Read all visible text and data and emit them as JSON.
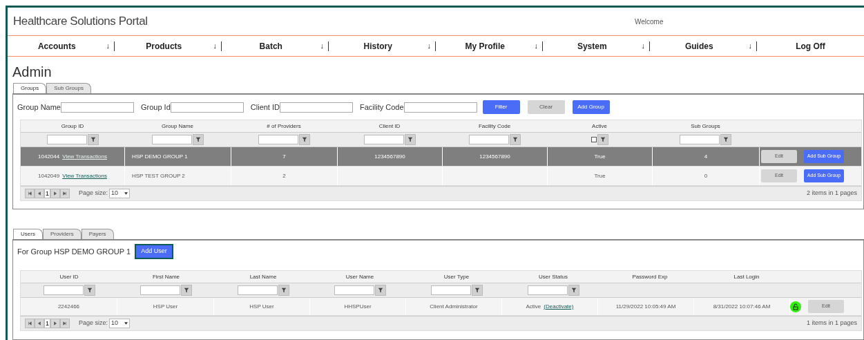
{
  "header": {
    "title": "Healthcare Solutions Portal",
    "welcome": "Welcome"
  },
  "nav": [
    {
      "label": "Accounts",
      "arrow": "↓"
    },
    {
      "label": "Products",
      "arrow": "↓"
    },
    {
      "label": "Batch",
      "arrow": "↓"
    },
    {
      "label": "History",
      "arrow": "↓"
    },
    {
      "label": "My Profile",
      "arrow": "↓"
    },
    {
      "label": "System",
      "arrow": "↓"
    },
    {
      "label": "Guides",
      "arrow": "↓"
    },
    {
      "label": "Log Off"
    }
  ],
  "page_title": "Admin",
  "group_tabs": [
    {
      "label": "Groups",
      "selected": true
    },
    {
      "label": "Sub Groups",
      "selected": false
    }
  ],
  "filter_form": {
    "fields": [
      {
        "label": "Group Name"
      },
      {
        "label": "Group Id"
      },
      {
        "label": "Client ID"
      },
      {
        "label": "Facility Code"
      }
    ],
    "buttons": [
      {
        "label": "Filter",
        "kind": "primary"
      },
      {
        "label": "Clear",
        "kind": "secondary"
      },
      {
        "label": "Add Group",
        "kind": "primary"
      }
    ]
  },
  "groups_grid": {
    "columns": [
      {
        "label": "Group ID",
        "kind": "field"
      },
      {
        "label": "Group Name",
        "kind": "field"
      },
      {
        "label": "# of Providers",
        "kind": "field"
      },
      {
        "label": "Client ID",
        "kind": "field"
      },
      {
        "label": "Facility Code",
        "kind": "field"
      },
      {
        "label": "Active",
        "kind": "checkbox",
        "checked": false
      },
      {
        "label": "Sub Groups",
        "kind": "field"
      },
      {
        "kind": "plain"
      }
    ],
    "rows": [
      {
        "selected": true,
        "cells": [
          {
            "text": "1042044",
            "link": "View Transactions"
          },
          {
            "text": "HSP DEMO GROUP 1"
          },
          {
            "text": "7"
          },
          {
            "text": "1234567890"
          },
          {
            "text": "1234567890"
          },
          {
            "text": "True"
          },
          {
            "text": "4"
          }
        ],
        "actions": [
          {
            "label": "Edit",
            "kind": "secondary"
          },
          {
            "label": "Add Sub Group",
            "kind": "primary"
          }
        ]
      },
      {
        "selected": false,
        "cells": [
          {
            "text": "1042049",
            "link": "View Transactions"
          },
          {
            "text": "HSP TEST GROUP 2"
          },
          {
            "text": "2"
          },
          {},
          {},
          {
            "text": "True"
          },
          {
            "text": "0"
          }
        ],
        "actions": [
          {
            "label": "Edit",
            "kind": "secondary"
          },
          {
            "label": "Add Sub Group",
            "kind": "primary"
          }
        ]
      }
    ],
    "pager": {
      "page": "1",
      "page_size_label": "Page size:",
      "page_size": "10",
      "summary": "2 items in 1 pages"
    }
  },
  "user_tabs": [
    {
      "label": "Users",
      "selected": true
    },
    {
      "label": "Providers",
      "selected": false
    },
    {
      "label": "Payers",
      "selected": false
    }
  ],
  "group_caption": "For Group HSP DEMO GROUP 1",
  "add_user_button": {
    "label": "Add User",
    "focused": true
  },
  "users_grid": {
    "columns": [
      {
        "label": "User ID",
        "kind": "field"
      },
      {
        "label": "First Name",
        "kind": "field"
      },
      {
        "label": "Last Name",
        "kind": "field"
      },
      {
        "label": "User Name",
        "kind": "field"
      },
      {
        "label": "User Type",
        "kind": "field"
      },
      {
        "label": "User Status",
        "kind": "field"
      },
      {
        "label": "Password Exp",
        "kind": "plain"
      },
      {
        "label": "Last Login",
        "kind": "plain"
      },
      {
        "kind": "plain"
      }
    ],
    "rows": [
      {
        "selected": false,
        "cells": [
          {
            "text": "2242466"
          },
          {
            "text": "HSP User"
          },
          {
            "text": "HSP User"
          },
          {
            "text": "HHSPUser"
          },
          {
            "text": "Client Administrator"
          },
          {
            "text": "Active",
            "link": "(Deactivate)"
          },
          {
            "text": "11/29/2022 10:05:49 AM"
          },
          {
            "text": "8/31/2022 10:07:46 AM"
          }
        ],
        "locked": false,
        "actions": [
          {
            "label": "Edit",
            "kind": "secondary"
          }
        ]
      }
    ],
    "pager": {
      "page": "1",
      "page_size_label": "Page size:",
      "page_size": "10",
      "summary": "1 items in 1 pages"
    }
  }
}
